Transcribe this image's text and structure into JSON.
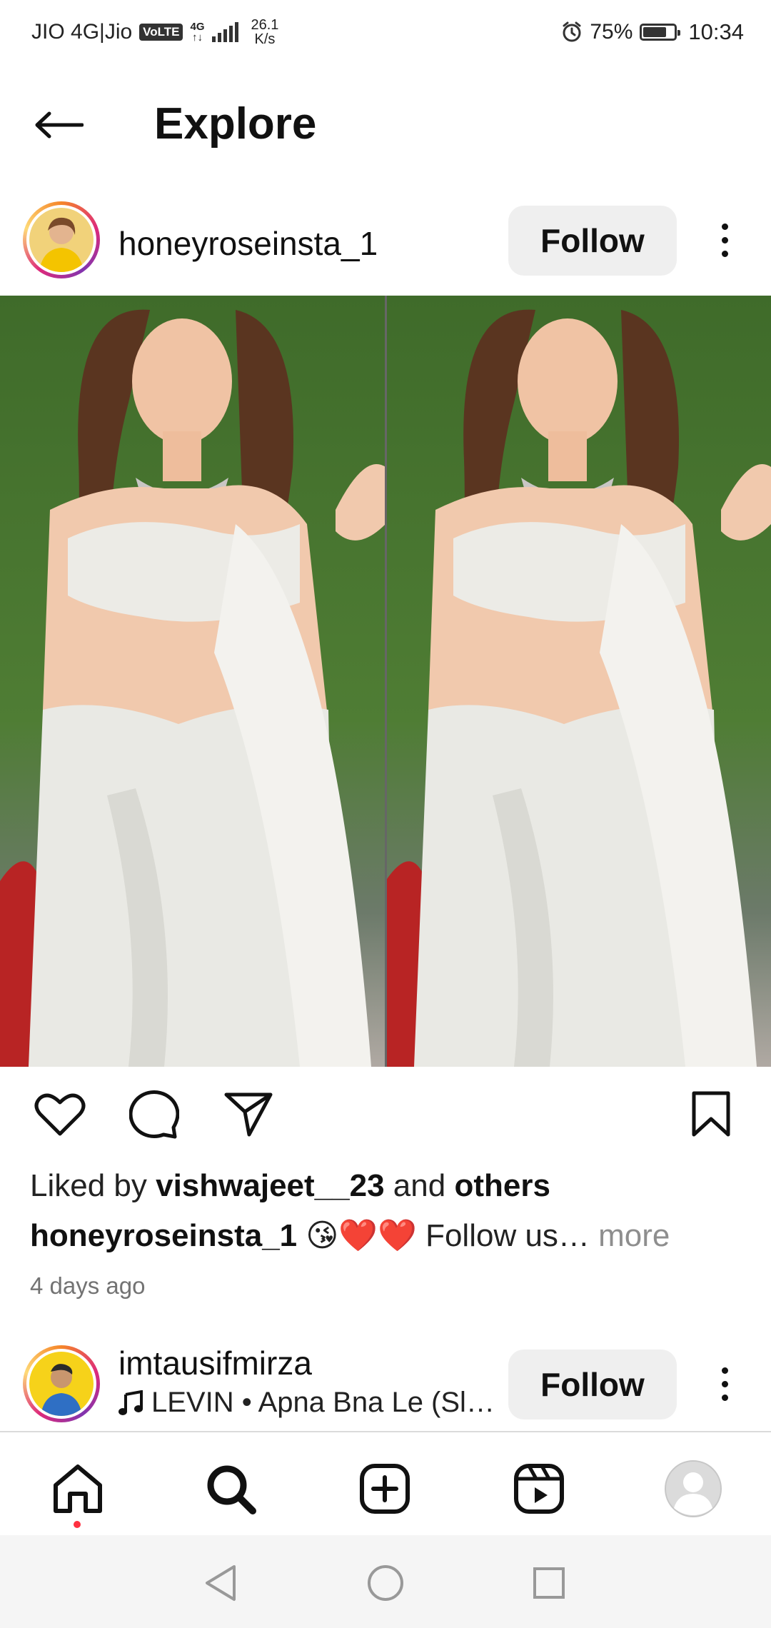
{
  "status_bar": {
    "carrier": "JIO 4G|Jio",
    "volte": "VoLTE",
    "net_top": "4G",
    "net_bottom": "↑↓",
    "speed_value": "26.1",
    "speed_unit": "K/s",
    "battery": "75%",
    "battery_level": 0.75,
    "time": "10:34"
  },
  "header": {
    "title": "Explore"
  },
  "post": {
    "username": "honeyroseinsta_1",
    "follow_label": "Follow",
    "likes_prefix": "Liked by ",
    "liked_by_user": "vishwajeet__23",
    "likes_mid": " and ",
    "likes_others": "others",
    "caption_user": "honeyroseinsta_1",
    "caption_emojis": "😘❤️❤️",
    "caption_text": " Follow us",
    "caption_ellipsis": "… ",
    "caption_more": "more",
    "timestamp": "4 days ago"
  },
  "next_post": {
    "username": "imtausifmirza",
    "audio_text": "LEVIN • Apna Bna Le (Sl…",
    "follow_label": "Follow"
  },
  "bottom_nav": {
    "items": [
      "home",
      "search",
      "create",
      "reels",
      "profile"
    ],
    "active": "search"
  },
  "colors": {
    "follow_bg": "#efefef",
    "notification_dot": "#ff3040",
    "secondary_text": "#737373"
  }
}
